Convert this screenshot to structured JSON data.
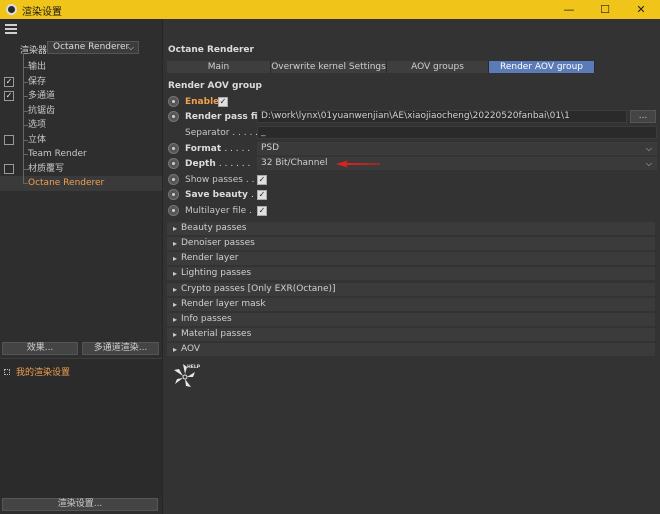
{
  "window": {
    "title": "渲染设置",
    "minimize": "—",
    "maximize": "☐",
    "close": "✕"
  },
  "left": {
    "renderer_label": "渲染器",
    "renderer_value": "Octane Renderer",
    "tree": [
      {
        "label": "输出",
        "checkbox": false,
        "checked": false
      },
      {
        "label": "保存",
        "checkbox": true,
        "checked": true
      },
      {
        "label": "多通道",
        "checkbox": true,
        "checked": true
      },
      {
        "label": "抗锯齿",
        "checkbox": false,
        "checked": false
      },
      {
        "label": "选项",
        "checkbox": false,
        "checked": false
      },
      {
        "label": "立体",
        "checkbox": true,
        "checked": false
      },
      {
        "label": "Team Render",
        "checkbox": false,
        "checked": false
      },
      {
        "label": "材质覆写",
        "checkbox": true,
        "checked": false
      },
      {
        "label": "Octane Renderer",
        "checkbox": false,
        "checked": false,
        "selected": true
      }
    ],
    "effects_button": "效果...",
    "multipass_button": "多通道渲染...",
    "preset_label": "我的渲染设置",
    "render_settings_button": "渲染设置..."
  },
  "right": {
    "panel_title": "Octane Renderer",
    "tabs": [
      {
        "label": "Main",
        "active": false
      },
      {
        "label": "Overwrite kernel Settings",
        "active": false
      },
      {
        "label": "AOV groups",
        "active": false
      },
      {
        "label": "Render AOV group",
        "active": true
      }
    ],
    "section_title": "Render AOV group",
    "enable_label": "Enable",
    "render_pass_file_label": "Render pass file",
    "render_pass_file_value": "D:\\work\\lynx\\01yuanwenjian\\AE\\xiaojiaocheng\\20220520fanbai\\01\\1",
    "browse_button": "...",
    "separator_label": "Separator . . . . .",
    "separator_value": "_",
    "format_label": "Format",
    "format_dots": ". . . . .",
    "format_value": "PSD",
    "depth_label": "Depth",
    "depth_dots": ". . . . . .",
    "depth_value": "32 Bit/Channel",
    "show_passes_label": "Show passes . .",
    "save_beauty_label": "Save beauty",
    "save_beauty_dots": ". .",
    "multilayer_label": "Multilayer file .",
    "groups": [
      "Beauty passes",
      "Denoiser passes",
      "Render layer",
      "Lighting passes",
      "Crypto passes [Only EXR(Octane)]",
      "Render layer mask",
      "Info passes",
      "Material passes",
      "AOV"
    ],
    "help_label": "HELP"
  },
  "colors": {
    "titlebar": "#f0c419",
    "active_tab": "#5a7bb8",
    "selected_text": "#f0a050",
    "arrow": "#e02020"
  }
}
